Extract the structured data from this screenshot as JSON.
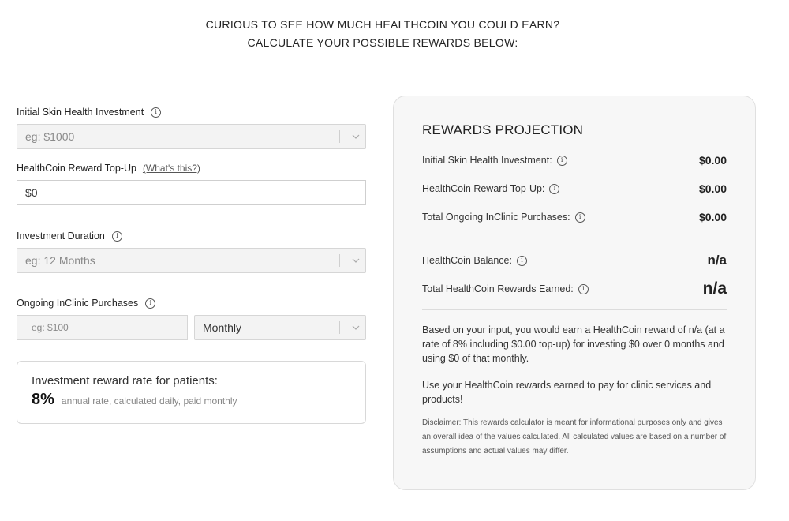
{
  "heading": {
    "line1": "CURIOUS TO SEE HOW MUCH HEALTHCOIN YOU COULD EARN?",
    "line2": "CALCULATE YOUR POSSIBLE REWARDS BELOW:"
  },
  "form": {
    "initial_investment": {
      "label": "Initial Skin Health Investment",
      "placeholder": "eg: $1000"
    },
    "topup": {
      "label": "HealthCoin Reward Top-Up",
      "link": "(What's this?)",
      "value": "$0"
    },
    "duration": {
      "label": "Investment Duration",
      "placeholder": "eg: 12 Months"
    },
    "purchases": {
      "label": "Ongoing InClinic Purchases",
      "placeholder": "eg: $100",
      "frequency": "Monthly"
    }
  },
  "rate_card": {
    "title": "Investment reward rate for patients:",
    "rate": "8%",
    "description": "annual rate, calculated daily, paid monthly"
  },
  "projection": {
    "title": "REWARDS PROJECTION",
    "rows": [
      {
        "label": "Initial Skin Health Investment:",
        "value": "$0.00"
      },
      {
        "label": "HealthCoin Reward Top-Up:",
        "value": "$0.00"
      },
      {
        "label": "Total Ongoing InClinic Purchases:",
        "value": "$0.00"
      }
    ],
    "balance": {
      "label": "HealthCoin Balance:",
      "value": "n/a"
    },
    "earned": {
      "label": "Total HealthCoin Rewards Earned:",
      "value": "n/a"
    },
    "summary": "Based on your input, you would earn a HealthCoin reward of n/a (at a rate of 8% including $0.00 top-up) for investing $0 over 0 months and using $0 of that monthly.",
    "use_text": "Use your HealthCoin rewards earned to pay for clinic services and products!",
    "disclaimer": "Disclaimer: This rewards calculator is meant for informational purposes only and gives an overall idea of the values calculated. All calculated values are based on a number of assumptions and actual values may differ."
  },
  "icons": {
    "info": "info-icon",
    "chevron": "chevron-down-icon"
  }
}
